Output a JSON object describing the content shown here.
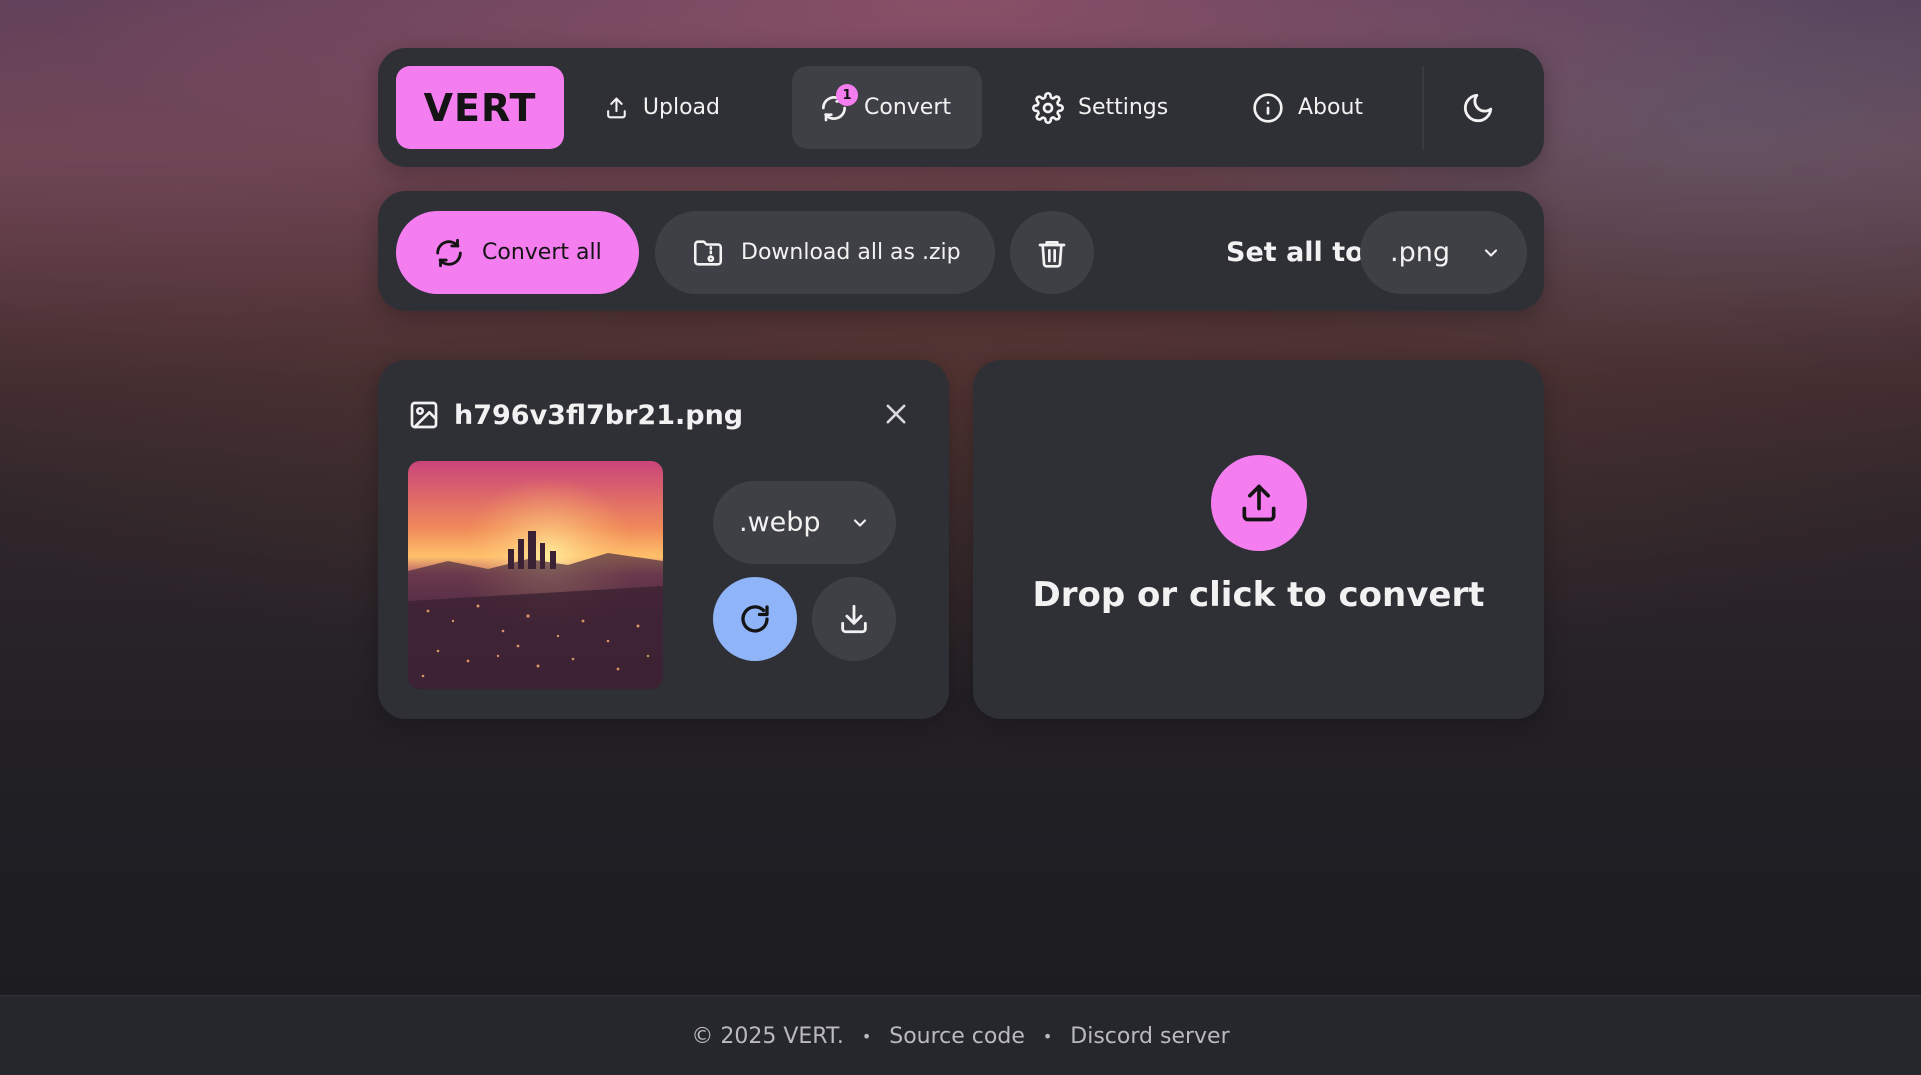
{
  "nav": {
    "logo": "VERT",
    "items": [
      {
        "label": "Upload",
        "icon": "upload-icon"
      },
      {
        "label": "Convert",
        "icon": "convert-icon",
        "badge": "1",
        "active": true
      },
      {
        "label": "Settings",
        "icon": "gear-icon"
      },
      {
        "label": "About",
        "icon": "info-icon"
      }
    ],
    "theme_icon": "moon-icon"
  },
  "toolbar": {
    "convert_all_label": "Convert all",
    "download_zip_label": "Download all as .zip",
    "delete_icon": "trash-icon",
    "set_all_label": "Set all to",
    "set_all_value": ".png"
  },
  "file": {
    "name": "h796v3fl7br21.png",
    "target_format": ".webp"
  },
  "dropzone": {
    "text": "Drop or click to convert"
  },
  "footer": {
    "copyright": "© 2025 VERT.",
    "source_link": "Source code",
    "discord_link": "Discord server"
  },
  "colors": {
    "accent": "#f47ef0",
    "blue": "#8fb4f8",
    "panel": "#2f3036"
  }
}
